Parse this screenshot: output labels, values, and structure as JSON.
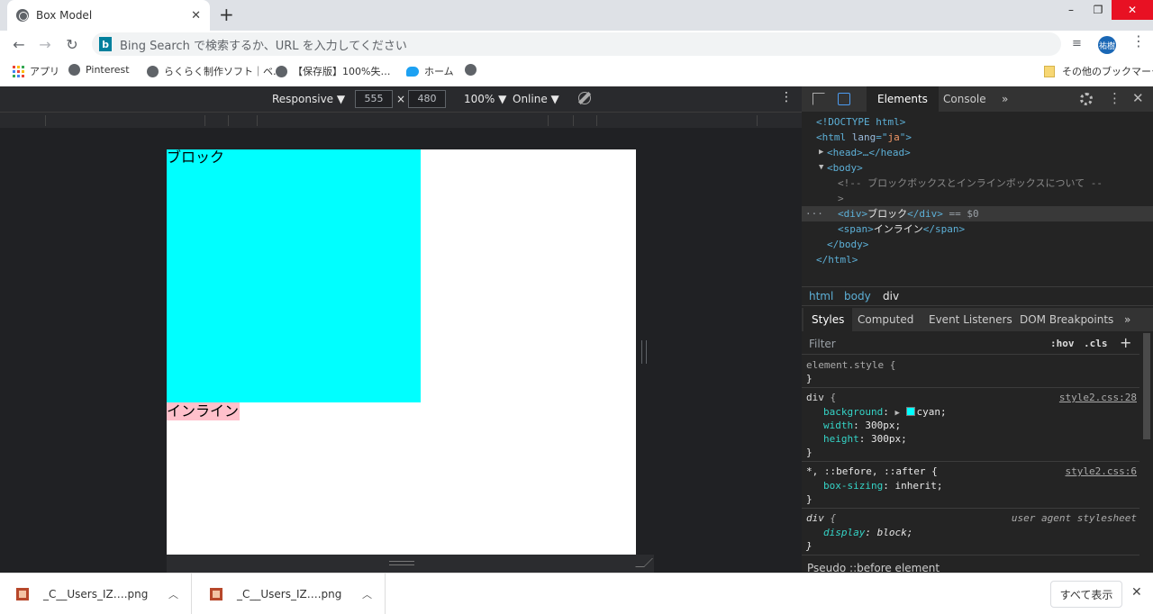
{
  "browser": {
    "tab_title": "Box Model",
    "tab_close": "✕",
    "new_tab": "+",
    "win_min": "–",
    "win_max": "❐",
    "win_close": "✕",
    "back": "←",
    "forward": "→",
    "reload": "↻",
    "bing_letter": "b",
    "omnibox_placeholder": "Bing Search で検索するか、URL を入力してください",
    "avatar_text": "祐樹",
    "menu": "⋮",
    "reading_list": "≡"
  },
  "bookmarks": {
    "items": [
      "アプリ",
      "Pinterest",
      "らくらく制作ソフト｜ベ…",
      "【保存版】100%失…",
      "ホーム",
      ""
    ],
    "other": "その他のブックマーク"
  },
  "device_toolbar": {
    "mode": "Responsive ▼",
    "width": "555",
    "times": "×",
    "height": "480",
    "zoom": "100% ▼",
    "network": "Online ▼",
    "more": "⋮"
  },
  "page": {
    "block_text": "ブロック",
    "inline_text": "インライン",
    "colors": {
      "block_bg": "#00ffff",
      "inline_bg": "#ffc0cb"
    }
  },
  "devtools": {
    "tabs": {
      "elements": "Elements",
      "console": "Console",
      "overflow": "»",
      "menu": "⋮",
      "close": "✕"
    },
    "dom": {
      "doctype": "<!DOCTYPE html>",
      "html_open": "<html",
      "lang_attr": " lang",
      "lang_eq": "=\"",
      "lang_val": "ja",
      "lang_close": "\">",
      "head_tri": "▶",
      "head": "<head>…</head>",
      "body_tri": "▼",
      "body_open": "<body>",
      "comment_1": "<!-- ブロックボックスとインラインボックスについて --",
      "comment_2": ">",
      "dots": "···",
      "div_open": "<div>",
      "div_text": "ブロック",
      "div_close": "</div>",
      "sel_ref": " == $0",
      "span_open": "<span>",
      "span_text": "インライン",
      "span_close": "</span>",
      "body_close": "</body>",
      "html_close": "</html>"
    },
    "breadcrumbs": [
      "html",
      "body",
      "div"
    ],
    "styles_tabs": [
      "Styles",
      "Computed",
      "Event Listeners",
      "DOM Breakpoints",
      "»"
    ],
    "filter_placeholder": "Filter",
    "hov": ":hov",
    "cls": ".cls",
    "plus": "+",
    "rules": {
      "element_style_sel": "element.style {",
      "element_style_end": "}",
      "div_sel": "div",
      "div_brace": " {",
      "div_src": "style2.css:28",
      "bg_name": "background",
      "bg_value": "cyan;",
      "width_name": "width",
      "width_value": "300px;",
      "height_name": "height",
      "height_value": "300px;",
      "div_end": "}",
      "univ_sel": "*, ::before, ::after {",
      "univ_src": "style2.css:6",
      "bs_name": "box-sizing",
      "bs_value": "inherit;",
      "univ_end": "}",
      "ua_sel": "div",
      "ua_brace": " {",
      "ua_src": "user agent stylesheet",
      "disp_name": "display",
      "disp_value": "block;",
      "ua_end": "}"
    },
    "pseudo": "Pseudo ::before element"
  },
  "downloads": {
    "items": [
      "_C__Users_IZ….png",
      "_C__Users_IZ….png"
    ],
    "chevron": "︿",
    "show_all": "すべて表示",
    "close": "✕"
  }
}
